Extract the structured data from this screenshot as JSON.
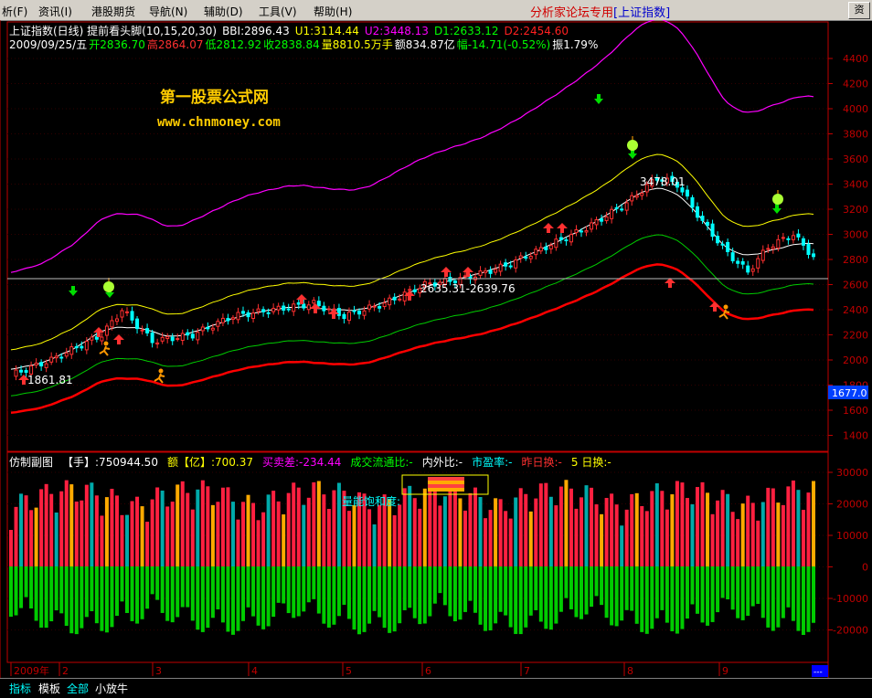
{
  "menu": {
    "items": [
      "析(F)",
      "资讯(I)",
      "港股期货",
      "导航(N)",
      "辅助(D)",
      "工具(V)",
      "帮助(H)"
    ],
    "promo_prefix": "分析家论坛专用",
    "promo_index": "[上证指数]",
    "right_button": "资"
  },
  "main_header": {
    "line1": [
      {
        "text": "上证指数(日线) 提前看头脚(10,15,20,30)",
        "color": "#ffffff"
      },
      {
        "text": "BBI:2896.43",
        "color": "#ffffff"
      },
      {
        "text": "U1:3114.44",
        "color": "#ffff00"
      },
      {
        "text": "U2:3448.13",
        "color": "#ff00ff"
      },
      {
        "text": "D1:2633.12",
        "color": "#00ff00"
      },
      {
        "text": "D2:2454.60",
        "color": "#ff2020"
      }
    ],
    "line2": [
      {
        "text": "2009/09/25/五",
        "color": "#ffffff"
      },
      {
        "text": "开2836.70",
        "color": "#00ff00"
      },
      {
        "text": "高2864.07",
        "color": "#ff3030"
      },
      {
        "text": "低2812.92",
        "color": "#00ff00"
      },
      {
        "text": "收2838.84",
        "color": "#00ff00"
      },
      {
        "text": "量8810.5万手",
        "color": "#ffff00"
      },
      {
        "text": "额834.87亿",
        "color": "#ffffff"
      },
      {
        "text": "幅-14.71(-0.52%)",
        "color": "#00ff00"
      },
      {
        "text": "振1.79%",
        "color": "#ffffff"
      }
    ]
  },
  "watermark": {
    "title": "第一股票公式网",
    "url": "www.chnmoney.com"
  },
  "annotations": {
    "low": "1861.81",
    "high": "3478.01",
    "range": "2635.31-2639.76",
    "current_price": "1677.0"
  },
  "price_axis": {
    "labels": [
      "4400",
      "4200",
      "4000",
      "3800",
      "3600",
      "3400",
      "3200",
      "3000",
      "2800",
      "2600",
      "2400",
      "2200",
      "2000",
      "1800",
      "1600",
      "1400"
    ]
  },
  "sub_header": [
    {
      "text": "仿制副图",
      "color": "#ffffff"
    },
    {
      "text": "【手】:750944.50",
      "color": "#ffffff"
    },
    {
      "text": "额【亿】:700.37",
      "color": "#ffff00"
    },
    {
      "text": "买卖差:-234.44",
      "color": "#ff00ff"
    },
    {
      "text": "成交流通比:-",
      "color": "#00ff00"
    },
    {
      "text": "内外比:-",
      "color": "#ffffff"
    },
    {
      "text": "市盈率:-",
      "color": "#00ffff"
    },
    {
      "text": "昨日换:-",
      "color": "#ff3030"
    },
    {
      "text": "5 日换:-",
      "color": "#ffff00"
    }
  ],
  "sub_label": "量能饱和度:",
  "volume_axis": {
    "labels": [
      "30000",
      "20000",
      "10000",
      "0",
      "-10000",
      "-20000"
    ]
  },
  "time_axis": {
    "labels": [
      "2009年",
      "2",
      "3",
      "4",
      "5",
      "6",
      "7",
      "8",
      "9"
    ]
  },
  "tabs": [
    "指标",
    "模板",
    "全部",
    "小放牛"
  ],
  "colors": {
    "up": "#ff3030",
    "down": "#00ffff",
    "axis": "#c00000",
    "bbi": "#ffffff",
    "u1": "#ffff00",
    "u2": "#ff00ff",
    "d1": "#00cc00",
    "d2": "#ff0000"
  }
}
